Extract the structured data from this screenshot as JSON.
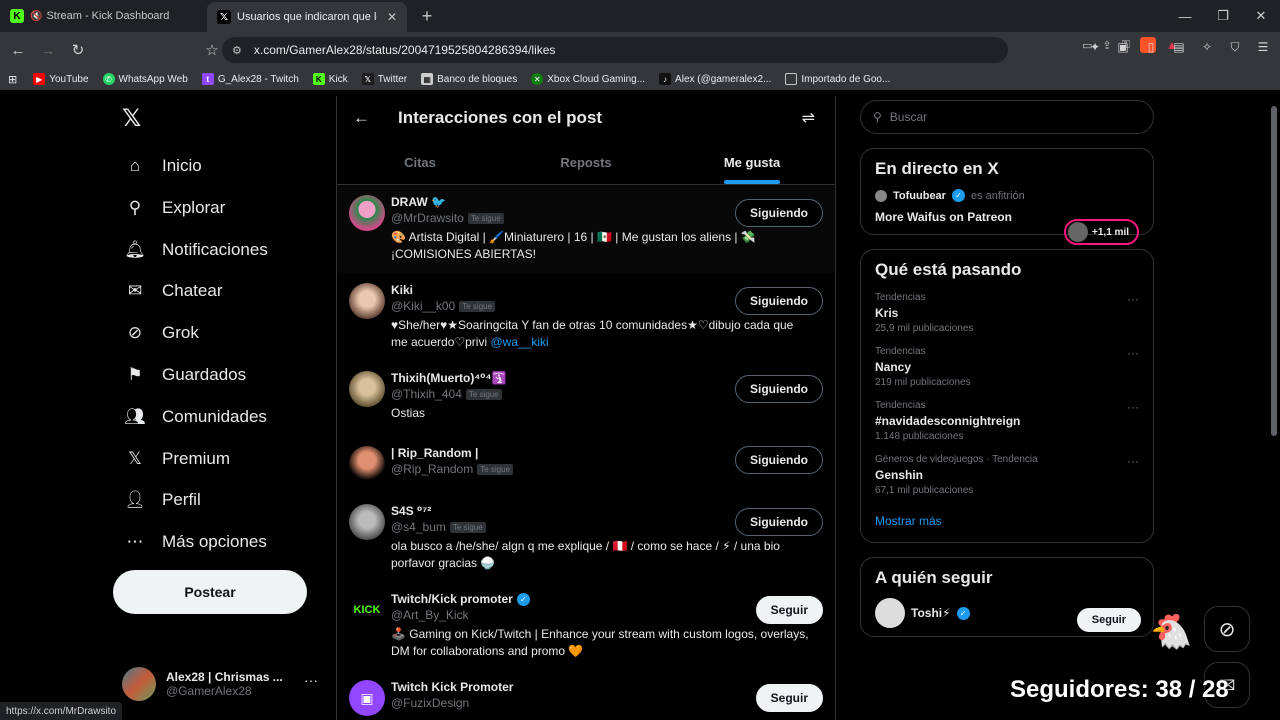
{
  "browser": {
    "tabs": [
      {
        "title": "Stream - Kick Dashboard"
      },
      {
        "title": "Usuarios que indicaron que les g"
      }
    ],
    "url": "x.com/GamerAlex28/status/2004719525804286394/likes",
    "bookmarks": [
      {
        "label": "YouTube",
        "color": "#ff0000"
      },
      {
        "label": "WhatsApp Web",
        "color": "#25d366"
      },
      {
        "label": "G_Alex28 - Twitch",
        "color": "#9146ff"
      },
      {
        "label": "Kick",
        "color": "#53fc18"
      },
      {
        "label": "Twitter",
        "color": "#1d1d1d"
      },
      {
        "label": "Banco de bloques",
        "color": "#cccccc"
      },
      {
        "label": "Xbox Cloud Gaming...",
        "color": "#107c10"
      },
      {
        "label": "Alex (@gameralex2...",
        "color": "#111111"
      },
      {
        "label": "Importado de Goo...",
        "color": "#888888"
      }
    ],
    "status_url": "https://x.com/MrDrawsito"
  },
  "nav": {
    "items": [
      {
        "label": "Inicio",
        "icon": "home-icon"
      },
      {
        "label": "Explorar",
        "icon": "search-icon"
      },
      {
        "label": "Notificaciones",
        "icon": "bell-icon"
      },
      {
        "label": "Chatear",
        "icon": "mail-icon"
      },
      {
        "label": "Grok",
        "icon": "grok-icon"
      },
      {
        "label": "Guardados",
        "icon": "bookmark-icon"
      },
      {
        "label": "Comunidades",
        "icon": "people-icon"
      },
      {
        "label": "Premium",
        "icon": "x-logo-icon"
      },
      {
        "label": "Perfil",
        "icon": "person-icon"
      },
      {
        "label": "Más opciones",
        "icon": "more-circle-icon"
      }
    ],
    "post_label": "Postear",
    "account": {
      "name": "Alex28 | Chrismas ...",
      "handle": "@GamerAlex28"
    }
  },
  "main": {
    "title": "Interacciones con el post",
    "tabs": [
      "Citas",
      "Reposts",
      "Me gusta"
    ],
    "users": [
      {
        "name": "DRAW 🐦",
        "handle": "@MrDrawsito",
        "follows_you": "Te sigue",
        "bio": "🎨 Artista Digital | 🖌️Miniaturero | 16 | 🇲🇽 | Me gustan los aliens | 💸 ¡COMISIONES ABIERTAS!",
        "button": "Siguiendo",
        "avatar_color": "#d14a8a"
      },
      {
        "name": "Kiki",
        "handle": "@Kiki__k00",
        "follows_you": "Te sigue",
        "bio": "♥She/her♥★Soaringcita Y fan de otras 10 comunidades★♡dibujo cada que me acuerdo♡privi",
        "bio_link": "@wa__kiki",
        "button": "Siguiendo",
        "avatar_color": "#8a6a5a"
      },
      {
        "name": "Thixih(Muerto)⁴⁰⁴🛐",
        "handle": "@Thixih_404",
        "follows_you": "Te sigue",
        "bio": "Ostias",
        "button": "Siguiendo",
        "avatar_color": "#a08a6a"
      },
      {
        "name": "| Rip_Random |",
        "handle": "@Rip_Random",
        "follows_you": "Te sigue",
        "bio": "",
        "button": "Siguiendo",
        "avatar_color": "#c86a4a"
      },
      {
        "name": "S4S ⁰⁷²",
        "handle": "@s4_bum",
        "follows_you": "Te sigue",
        "bio": "ola busco a /he/she/ algn q me explique / 🇵🇪 / como se hace / ⚡ / una bio porfavor gracias 🍚",
        "button": "Siguiendo",
        "avatar_color": "#9a9a9a"
      },
      {
        "name": "Twitch/Kick promoter",
        "handle": "@Art_By_Kick",
        "follows_you": "",
        "bio": "🕹️ Gaming on Kick/Twitch | Enhance your stream with custom logos, overlays, DM for collaborations and promo 🧡",
        "button": "Seguir",
        "avatar_color": "#000000",
        "verified": true
      },
      {
        "name": "Twitch Kick Promoter",
        "handle": "@FuzixDesign",
        "follows_you": "",
        "bio": "",
        "button": "Seguir",
        "avatar_color": "#9146ff"
      }
    ]
  },
  "sidebar": {
    "search_placeholder": "Buscar",
    "live": {
      "title": "En directo en X",
      "host": "Tofuubear",
      "role": "es anfitrión",
      "stream_title": "More Waifus on Patreon",
      "listeners": "+1,1 mil"
    },
    "trends": {
      "title": "Qué está pasando",
      "items": [
        {
          "category": "Tendencias",
          "name": "Kris",
          "count": "25,9 mil publicaciones"
        },
        {
          "category": "Tendencias",
          "name": "Nancy",
          "count": "219 mil publicaciones"
        },
        {
          "category": "Tendencias",
          "name": "#navidadesconnightreign",
          "count": "1.148 publicaciones"
        },
        {
          "category": "Géneros de videojuegos · Tendencia",
          "name": "Genshin",
          "count": "67,1 mil publicaciones"
        }
      ],
      "show_more": "Mostrar más"
    },
    "who_to_follow": {
      "title": "A quién seguir",
      "first_name": "Toshi⚡",
      "button": "Seguir"
    }
  },
  "overlay": {
    "followers": "Seguidores: 38 / 28"
  }
}
